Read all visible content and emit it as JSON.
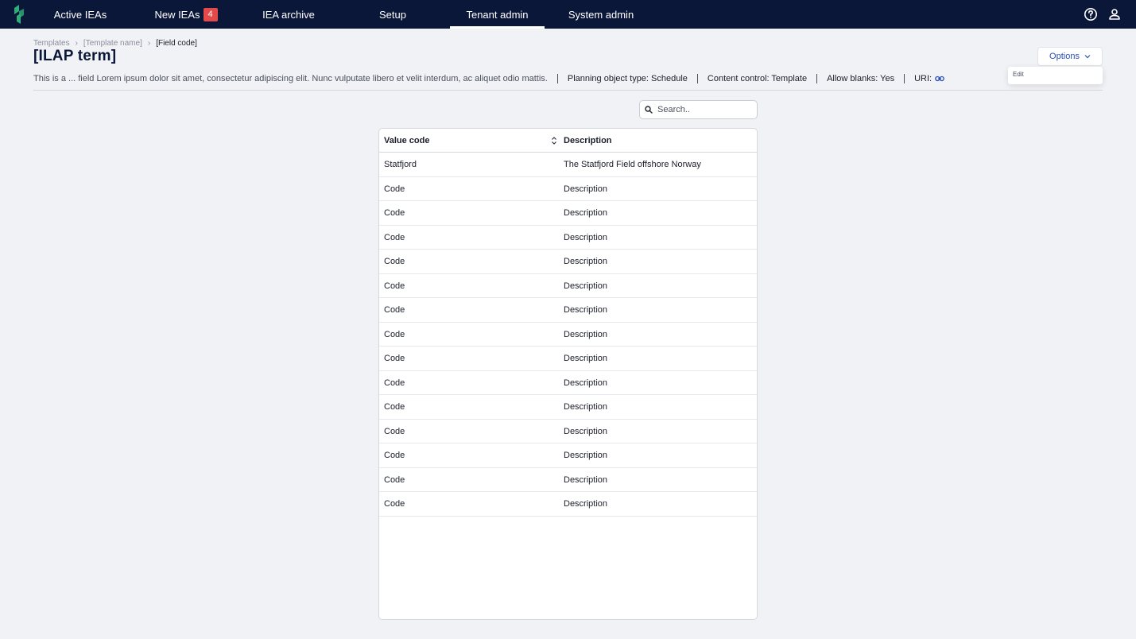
{
  "nav": {
    "items": [
      {
        "label": "Active IEAs"
      },
      {
        "label": "New IEAs",
        "badge": "4"
      },
      {
        "label": "IEA archive"
      },
      {
        "label": "Setup"
      },
      {
        "label": "Tenant admin",
        "active": true
      },
      {
        "label": "System admin"
      }
    ],
    "icons": [
      "help-icon",
      "user-icon"
    ],
    "colors": {
      "bar": "#0b1739",
      "badge": "#e44a4a",
      "logo": "#2fae7a"
    }
  },
  "breadcrumb": {
    "items": [
      "Templates",
      "[Template name]",
      "[Field code]"
    ]
  },
  "page": {
    "title": "[ILAP term]",
    "description": "This is a ... field Lorem ipsum dolor sit amet, consectetur adipiscing elit. Nunc vulputate libero et velit interdum, ac aliquet odio mattis.",
    "meta": {
      "planning_object_type": "Planning object type: Schedule",
      "content_control": "Content control: Template",
      "allow_blanks": "Allow blanks: Yes",
      "uri_label": "URI:"
    }
  },
  "options": {
    "label": "Options",
    "menu": [
      "Edit"
    ]
  },
  "search": {
    "placeholder": "Search.."
  },
  "table": {
    "columns": [
      "Value code",
      "Description"
    ],
    "rows": [
      {
        "code": "Statfjord",
        "description": "The Statfjord Field offshore Norway"
      },
      {
        "code": "Code",
        "description": "Description"
      },
      {
        "code": "Code",
        "description": "Description"
      },
      {
        "code": "Code",
        "description": "Description"
      },
      {
        "code": "Code",
        "description": "Description"
      },
      {
        "code": "Code",
        "description": "Description"
      },
      {
        "code": "Code",
        "description": "Description"
      },
      {
        "code": "Code",
        "description": "Description"
      },
      {
        "code": "Code",
        "description": "Description"
      },
      {
        "code": "Code",
        "description": "Description"
      },
      {
        "code": "Code",
        "description": "Description"
      },
      {
        "code": "Code",
        "description": "Description"
      },
      {
        "code": "Code",
        "description": "Description"
      },
      {
        "code": "Code",
        "description": "Description"
      },
      {
        "code": "Code",
        "description": "Description"
      }
    ]
  }
}
